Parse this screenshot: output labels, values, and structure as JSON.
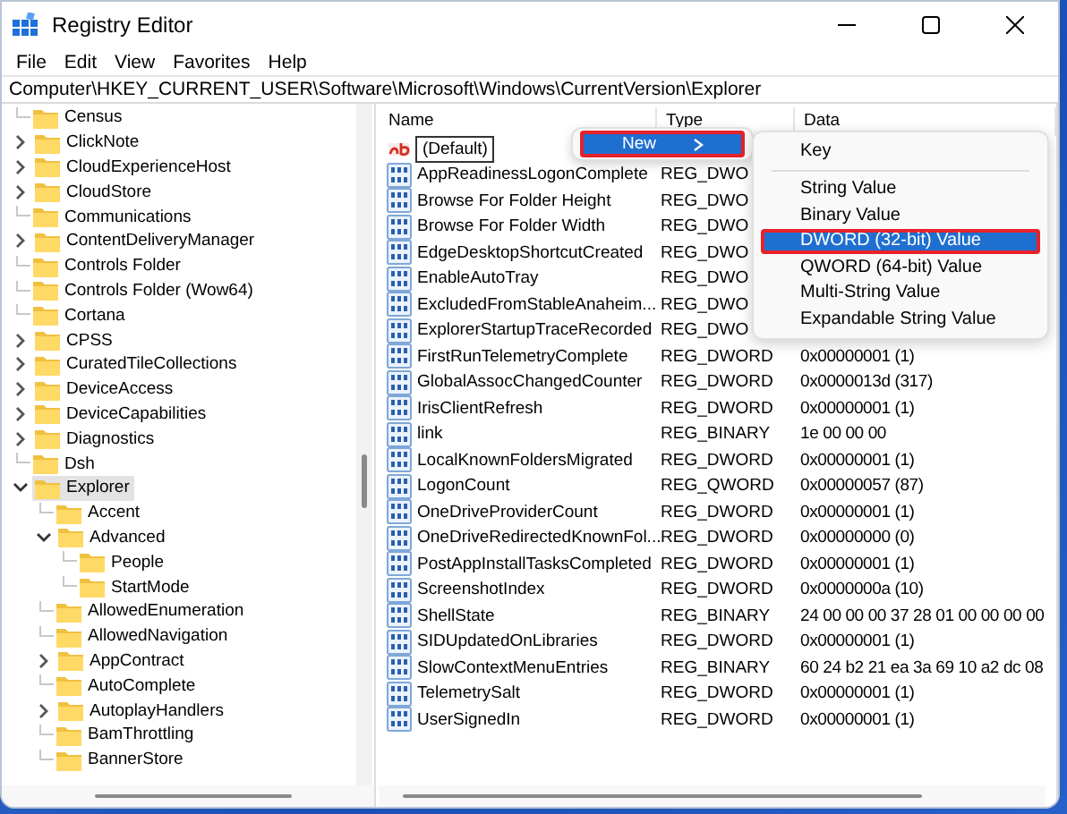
{
  "window": {
    "title": "Registry Editor"
  },
  "menu_bar": [
    "File",
    "Edit",
    "View",
    "Favorites",
    "Help"
  ],
  "address": "Computer\\HKEY_CURRENT_USER\\Software\\Microsoft\\Windows\\CurrentVersion\\Explorer",
  "tree": [
    {
      "label": "Census",
      "expandable": false,
      "selected": false
    },
    {
      "label": "ClickNote",
      "expandable": true,
      "expanded": false,
      "selected": false
    },
    {
      "label": "CloudExperienceHost",
      "expandable": true,
      "expanded": false,
      "selected": false
    },
    {
      "label": "CloudStore",
      "expandable": true,
      "expanded": false,
      "selected": false
    },
    {
      "label": "Communications",
      "expandable": false,
      "selected": false
    },
    {
      "label": "ContentDeliveryManager",
      "expandable": true,
      "expanded": false,
      "selected": false
    },
    {
      "label": "Controls Folder",
      "expandable": false,
      "selected": false
    },
    {
      "label": "Controls Folder (Wow64)",
      "expandable": false,
      "selected": false
    },
    {
      "label": "Cortana",
      "expandable": false,
      "selected": false
    },
    {
      "label": "CPSS",
      "expandable": true,
      "expanded": false,
      "selected": false
    },
    {
      "label": "CuratedTileCollections",
      "expandable": true,
      "expanded": false,
      "selected": false
    },
    {
      "label": "DeviceAccess",
      "expandable": true,
      "expanded": false,
      "selected": false
    },
    {
      "label": "DeviceCapabilities",
      "expandable": true,
      "expanded": false,
      "selected": false
    },
    {
      "label": "Diagnostics",
      "expandable": true,
      "expanded": false,
      "selected": false
    },
    {
      "label": "Dsh",
      "expandable": false,
      "selected": false
    },
    {
      "label": "Explorer",
      "expandable": true,
      "expanded": true,
      "selected": true,
      "children": [
        {
          "label": "Accent",
          "expandable": false,
          "selected": false
        },
        {
          "label": "Advanced",
          "expandable": true,
          "expanded": true,
          "selected": false,
          "children": [
            {
              "label": "People",
              "expandable": false,
              "selected": false
            },
            {
              "label": "StartMode",
              "expandable": false,
              "selected": false
            }
          ]
        },
        {
          "label": "AllowedEnumeration",
          "expandable": false,
          "selected": false
        },
        {
          "label": "AllowedNavigation",
          "expandable": false,
          "selected": false
        },
        {
          "label": "AppContract",
          "expandable": true,
          "expanded": false,
          "selected": false
        },
        {
          "label": "AutoComplete",
          "expandable": false,
          "selected": false
        },
        {
          "label": "AutoplayHandlers",
          "expandable": true,
          "expanded": false,
          "selected": false
        },
        {
          "label": "BamThrottling",
          "expandable": false,
          "selected": false
        },
        {
          "label": "BannerStore",
          "expandable": false,
          "selected": false
        }
      ]
    }
  ],
  "values": {
    "columns": [
      "Name",
      "Type",
      "Data"
    ],
    "rows": [
      {
        "kind": "string",
        "name": "(Default)",
        "renaming": true
      },
      {
        "kind": "binary",
        "name": "AppReadinessLogonComplete",
        "type": "REG_DWO",
        "renaming": false
      },
      {
        "kind": "binary",
        "name": "Browse For Folder Height",
        "type": "REG_DWO",
        "renaming": false
      },
      {
        "kind": "binary",
        "name": "Browse For Folder Width",
        "type": "REG_DWO",
        "renaming": false
      },
      {
        "kind": "binary",
        "name": "EdgeDesktopShortcutCreated",
        "type": "REG_DWO",
        "renaming": false
      },
      {
        "kind": "binary",
        "name": "EnableAutoTray",
        "type": "REG_DWO",
        "renaming": false
      },
      {
        "kind": "binary",
        "name": "ExcludedFromStableAnaheim...",
        "type": "REG_DWO",
        "renaming": false
      },
      {
        "kind": "binary",
        "name": "ExplorerStartupTraceRecorded",
        "type": "REG_DWO",
        "renaming": false
      },
      {
        "kind": "binary",
        "name": "FirstRunTelemetryComplete",
        "type": "REG_DWORD",
        "data": "0x00000001 (1)",
        "renaming": false
      },
      {
        "kind": "binary",
        "name": "GlobalAssocChangedCounter",
        "type": "REG_DWORD",
        "data": "0x0000013d (317)",
        "renaming": false
      },
      {
        "kind": "binary",
        "name": "IrisClientRefresh",
        "type": "REG_DWORD",
        "data": "0x00000001 (1)",
        "renaming": false
      },
      {
        "kind": "binary",
        "name": "link",
        "type": "REG_BINARY",
        "data": "1e 00 00 00",
        "renaming": false
      },
      {
        "kind": "binary",
        "name": "LocalKnownFoldersMigrated",
        "type": "REG_DWORD",
        "data": "0x00000001 (1)",
        "renaming": false
      },
      {
        "kind": "binary",
        "name": "LogonCount",
        "type": "REG_QWORD",
        "data": "0x00000057 (87)",
        "renaming": false
      },
      {
        "kind": "binary",
        "name": "OneDriveProviderCount",
        "type": "REG_DWORD",
        "data": "0x00000001 (1)",
        "renaming": false
      },
      {
        "kind": "binary",
        "name": "OneDriveRedirectedKnownFol...",
        "type": "REG_DWORD",
        "data": "0x00000000 (0)",
        "renaming": false
      },
      {
        "kind": "binary",
        "name": "PostAppInstallTasksCompleted",
        "type": "REG_DWORD",
        "data": "0x00000001 (1)",
        "renaming": false
      },
      {
        "kind": "binary",
        "name": "ScreenshotIndex",
        "type": "REG_DWORD",
        "data": "0x0000000a (10)",
        "renaming": false
      },
      {
        "kind": "binary",
        "name": "ShellState",
        "type": "REG_BINARY",
        "data": "24 00 00 00 37 28 01 00 00 00 00",
        "renaming": false
      },
      {
        "kind": "binary",
        "name": "SIDUpdatedOnLibraries",
        "type": "REG_DWORD",
        "data": "0x00000001 (1)",
        "renaming": false
      },
      {
        "kind": "binary",
        "name": "SlowContextMenuEntries",
        "type": "REG_BINARY",
        "data": "60 24 b2 21 ea 3a 69 10 a2 dc 08",
        "renaming": false
      },
      {
        "kind": "binary",
        "name": "TelemetrySalt",
        "type": "REG_DWORD",
        "data": "0x00000001 (1)",
        "renaming": false
      },
      {
        "kind": "binary",
        "name": "UserSignedIn",
        "type": "REG_DWORD",
        "data": "0x00000001 (1)",
        "renaming": false
      }
    ]
  },
  "context_menu": {
    "items": [
      {
        "label": "New",
        "selected": true,
        "highlighted": true,
        "has_submenu": true
      }
    ]
  },
  "submenu": {
    "items": [
      {
        "kind": "item",
        "label": "Key",
        "selected": false,
        "highlighted": false
      },
      {
        "kind": "separator"
      },
      {
        "kind": "item",
        "label": "String Value",
        "selected": false,
        "highlighted": false
      },
      {
        "kind": "item",
        "label": "Binary Value",
        "selected": false,
        "highlighted": false
      },
      {
        "kind": "item",
        "label": "DWORD (32-bit) Value",
        "selected": true,
        "highlighted": true
      },
      {
        "kind": "item",
        "label": "QWORD (64-bit) Value",
        "selected": false,
        "highlighted": false
      },
      {
        "kind": "item",
        "label": "Multi-String Value",
        "selected": false,
        "highlighted": false
      },
      {
        "kind": "item",
        "label": "Expandable String Value",
        "selected": false,
        "highlighted": false
      }
    ]
  }
}
